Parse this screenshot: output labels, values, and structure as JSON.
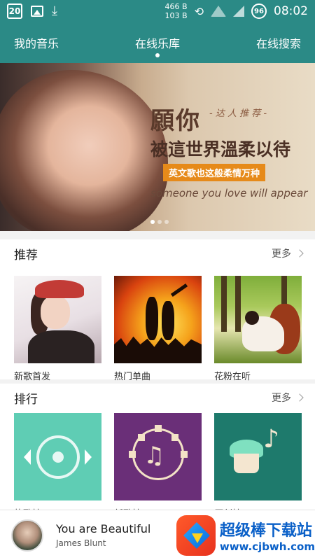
{
  "statusbar": {
    "calendar_day": "20",
    "speed_up": "466 B",
    "speed_down": "103 B",
    "battery": "96",
    "time": "08:02"
  },
  "topnav": {
    "tabs": [
      {
        "label": "我的音乐",
        "active": false
      },
      {
        "label": "在线乐库",
        "active": true
      },
      {
        "label": "在线搜索",
        "active": false
      }
    ]
  },
  "banner": {
    "title_line1": "願你",
    "subtitle": "- 达 人 推 荐 -",
    "title_line2": "被這世界溫柔以待",
    "tag": "英文歌也这般柔情万种",
    "english": "someone you love will appear"
  },
  "recommend": {
    "title": "推荐",
    "more": "更多",
    "items": [
      {
        "label": "新歌首发"
      },
      {
        "label": "热门单曲"
      },
      {
        "label": "花粉在听"
      }
    ]
  },
  "ranking": {
    "title": "排行",
    "more": "更多",
    "items": [
      {
        "label": "热歌榜"
      },
      {
        "label": "新歌榜"
      },
      {
        "label": "原创榜"
      }
    ]
  },
  "player": {
    "song_title": "You are Beautiful",
    "artist": "James Blunt"
  },
  "watermark": {
    "name": "超级棒下载站",
    "url": "www.cjbwh.com"
  },
  "colors": {
    "accent": "#2b8a86"
  }
}
